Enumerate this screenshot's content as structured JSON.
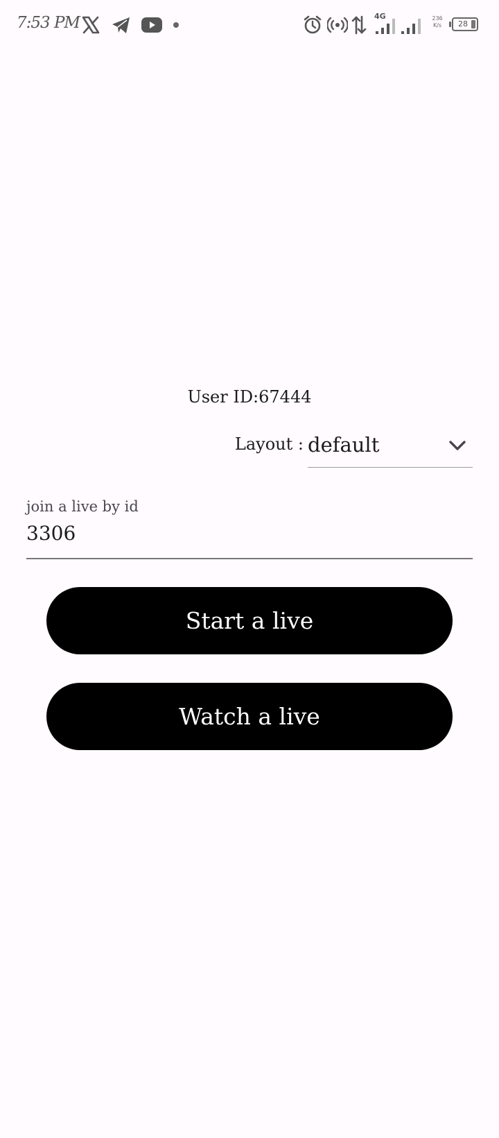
{
  "status_bar": {
    "time": "7:53 PM",
    "network_type": "4G",
    "net_speed_value": "236",
    "net_speed_unit": "K/s",
    "battery_level": "28",
    "icons": [
      "x-icon",
      "telegram-icon",
      "youtube-icon",
      "notification-dot-icon",
      "alarm-icon",
      "hotspot-icon",
      "data-arrows-icon",
      "signal-icon",
      "signal-icon-2",
      "battery-icon"
    ]
  },
  "main": {
    "user_id_text": "User ID:67444",
    "layout_label": "Layout :",
    "layout_selected": "default",
    "join_label": "join a live by id",
    "join_value": "3306",
    "start_button": "Start a live",
    "watch_button": "Watch a live"
  }
}
